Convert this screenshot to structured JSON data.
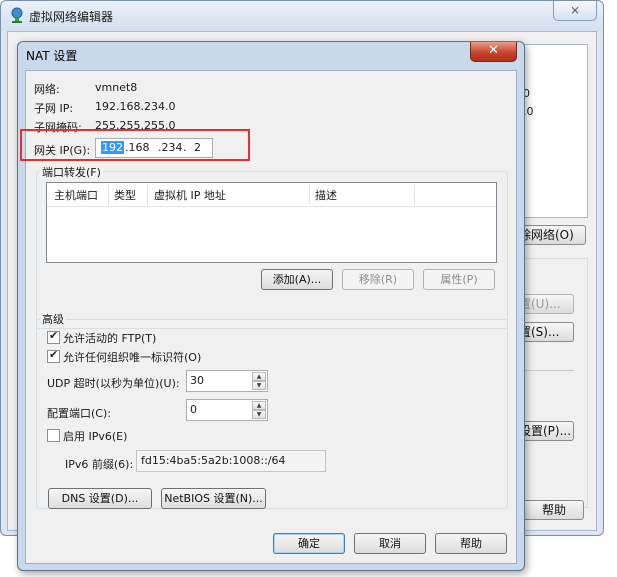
{
  "background_window": {
    "title": "虚拟网络编辑器",
    "close_glyph": "⨯",
    "partial_text_1": "0",
    "partial_text_2": ".0",
    "remove_network_button": "除网络(O)",
    "setting_button_disabled": "置(U)...",
    "setting_button_2": "置(S)...",
    "setting_button_3": "设置(P)...",
    "help_button": "帮助"
  },
  "dialog": {
    "title": "NAT 设置",
    "close_glyph": "✕",
    "network_label": "网络:",
    "network_value": "vmnet8",
    "subnet_ip_label": "子网 IP:",
    "subnet_ip_value": "192.168.234.0",
    "subnet_mask_label": "子网掩码:",
    "subnet_mask_value": "255.255.255.0",
    "gateway_label": "网关 IP(G):",
    "gateway_segments": [
      "192",
      ".168",
      ".234",
      ".",
      "2"
    ],
    "port_forwarding": {
      "group_label": "端口转发(F)",
      "columns": [
        "主机端口",
        "类型",
        "虚拟机 IP 地址",
        "描述"
      ],
      "rows": [],
      "add_button": "添加(A)...",
      "remove_button": "移除(R)",
      "properties_button": "属性(P)"
    },
    "advanced": {
      "group_label": "高级",
      "allow_ftp": "允许活动的 FTP(T)",
      "allow_ftp_checked": true,
      "allow_oui": "允许任何组织唯一标识符(O)",
      "allow_oui_checked": true,
      "udp_timeout_label": "UDP 超时(以秒为单位)(U):",
      "udp_timeout_value": "30",
      "config_port_label": "配置端口(C):",
      "config_port_value": "0",
      "enable_ipv6": "启用 IPv6(E)",
      "enable_ipv6_checked": false,
      "ipv6_prefix_label": "IPv6 前缀(6):",
      "ipv6_prefix_value": "fd15:4ba5:5a2b:1008::/64"
    },
    "dns_button": "DNS 设置(D)...",
    "netbios_button": "NetBIOS 设置(N)...",
    "ok_button": "确定",
    "cancel_button": "取消",
    "help_button": "帮助"
  },
  "colors": {
    "highlight_frame": "#e8302a",
    "selection": "#3399ff",
    "close_button": "#c8442c"
  }
}
